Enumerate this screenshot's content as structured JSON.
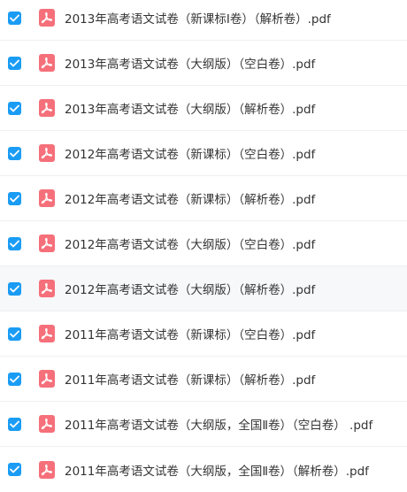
{
  "colors": {
    "checkbox": "#1a9cf5",
    "pdf_icon": "#f5707a",
    "text": "#333333",
    "row_highlight": "#f7f8fa",
    "divider": "#eef0f3"
  },
  "icons": {
    "checkbox": "checkmark-icon",
    "file": "pdf-file-icon"
  },
  "files": [
    {
      "name": "2013年高考语文试卷（新课标Ⅰ卷）（解析卷）.pdf",
      "checked": true
    },
    {
      "name": "2013年高考语文试卷（大纲版）（空白卷）.pdf",
      "checked": true
    },
    {
      "name": "2013年高考语文试卷（大纲版）（解析卷）.pdf",
      "checked": true
    },
    {
      "name": "2012年高考语文试卷（新课标）（空白卷）.pdf",
      "checked": true
    },
    {
      "name": "2012年高考语文试卷（新课标）（解析卷）.pdf",
      "checked": true
    },
    {
      "name": "2012年高考语文试卷（大纲版）（空白卷）.pdf",
      "checked": true
    },
    {
      "name": "2012年高考语文试卷（大纲版）（解析卷）.pdf",
      "checked": true,
      "highlighted": true
    },
    {
      "name": "2011年高考语文试卷（新课标）（空白卷）.pdf",
      "checked": true
    },
    {
      "name": "2011年高考语文试卷（新课标）（解析卷）.pdf",
      "checked": true
    },
    {
      "name": "2011年高考语文试卷（大纲版，全国Ⅱ卷）（空白卷） .pdf",
      "checked": true
    },
    {
      "name": "2011年高考语文试卷（大纲版，全国Ⅱ卷）（解析卷）.pdf",
      "checked": true
    }
  ]
}
